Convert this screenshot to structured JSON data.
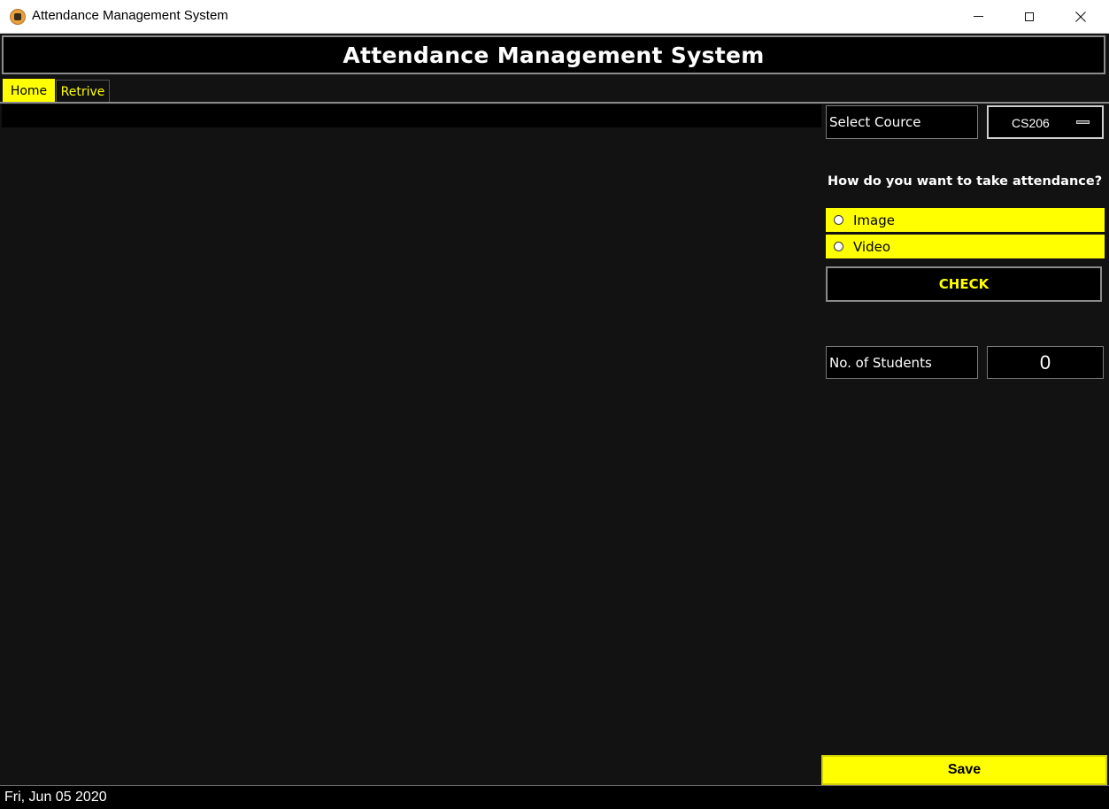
{
  "window": {
    "title": "Attendance Management System",
    "icon": "app-icon",
    "controls": {
      "minimize_icon": "minimize-icon",
      "maximize_icon": "maximize-icon",
      "close_icon": "close-icon",
      "close_glyph": "✕"
    }
  },
  "header": {
    "title": "Attendance Management System"
  },
  "tabs": [
    {
      "label": "Home",
      "active": true
    },
    {
      "label": "Retrive",
      "active": false
    }
  ],
  "side_panel": {
    "select_course_label": "Select Cource",
    "course_selected": "CS206",
    "question": "How do you want to take attendance?",
    "options": [
      {
        "label": "Image",
        "selected": false
      },
      {
        "label": "Video",
        "selected": false
      }
    ],
    "check_label": "CHECK",
    "students_label": "No. of Students",
    "students_count": "0",
    "save_label": "Save"
  },
  "status_bar": {
    "date": "Fri, Jun 05 2020"
  },
  "colors": {
    "accent": "#ffff00",
    "background": "#121212",
    "panel": "#000000",
    "text": "#ffffff"
  }
}
